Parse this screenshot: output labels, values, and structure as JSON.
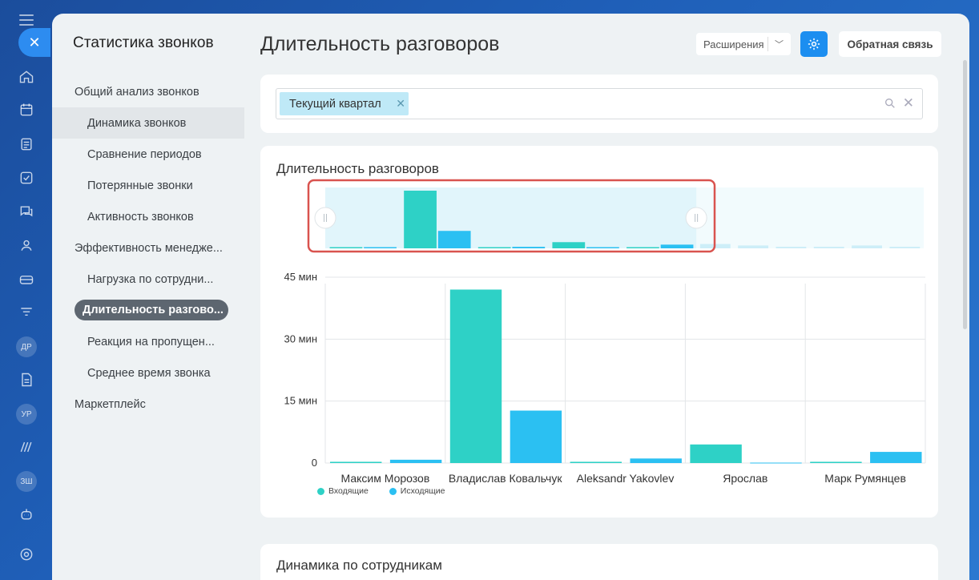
{
  "sidebar": {
    "title": "Статистика звонков",
    "items": [
      {
        "label": "Общий анализ звонков",
        "kind": "group"
      },
      {
        "label": "Динамика звонков",
        "kind": "sub",
        "highlight": true
      },
      {
        "label": "Сравнение периодов",
        "kind": "sub"
      },
      {
        "label": "Потерянные звонки",
        "kind": "sub"
      },
      {
        "label": "Активность звонков",
        "kind": "sub"
      },
      {
        "label": "Эффективность менедже...",
        "kind": "group"
      },
      {
        "label": "Нагрузка по сотрудни...",
        "kind": "sub"
      },
      {
        "label": "Длительность разгово...",
        "kind": "active"
      },
      {
        "label": "Реакция на пропущен...",
        "kind": "sub"
      },
      {
        "label": "Среднее время звонка",
        "kind": "sub"
      },
      {
        "label": "Маркетплейс",
        "kind": "group"
      }
    ]
  },
  "rail": {
    "badges": [
      "ДР",
      "УР",
      "ЗШ"
    ]
  },
  "header": {
    "title": "Длительность разговоров",
    "extensions_label": "Расширения",
    "feedback_label": "Обратная связь"
  },
  "filter": {
    "tag": "Текущий квартал"
  },
  "sections": {
    "chart_title": "Длительность разговоров",
    "next_title": "Динамика по сотрудникам"
  },
  "colors": {
    "incoming": "#2ed1c6",
    "outgoing": "#2bc0f2",
    "accent": "#1c8ef0",
    "highlight_frame": "#d9534f"
  },
  "chart_data": {
    "type": "bar",
    "categories": [
      "Максим Морозов",
      "Владислав Ковальчук",
      "Aleksandr Yakovlev",
      "Ярослав",
      "Марк Румянцев"
    ],
    "series": [
      {
        "name": "Входящие",
        "values": [
          0.3,
          42,
          0.3,
          4.5,
          0.3
        ]
      },
      {
        "name": "Исходящие",
        "values": [
          0.8,
          12.7,
          1.1,
          0.1,
          2.7
        ]
      }
    ],
    "yticks": [
      "0",
      "15 мин",
      "30 мин",
      "45 мин"
    ],
    "ytick_values": [
      0,
      15,
      30,
      45
    ],
    "ylim": [
      0,
      45
    ],
    "legend": "bottom-left",
    "grid": true
  },
  "navigator": {
    "window": [
      0,
      0.62
    ],
    "extra_bars": [
      0.9,
      0.6,
      0.3,
      0.3,
      0.6,
      0.3
    ]
  }
}
